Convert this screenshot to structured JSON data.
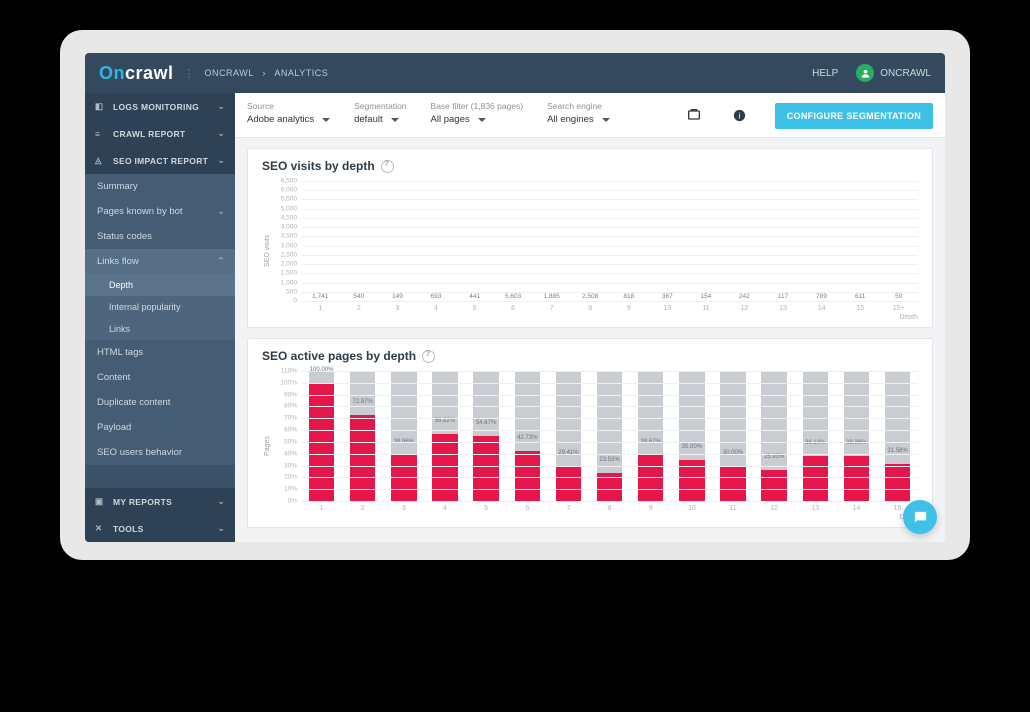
{
  "brand": {
    "on": "On",
    "rest": "crawl"
  },
  "breadcrumb": [
    "ONCRAWL",
    "ANALYTICS"
  ],
  "header": {
    "help": "HELP",
    "user": "ONCRAWL"
  },
  "filters": {
    "source": {
      "label": "Source",
      "value": "Adobe analytics"
    },
    "segmentation": {
      "label": "Segmentation",
      "value": "default"
    },
    "basefilter": {
      "label": "Base filter (1,836 pages)",
      "value": "All pages"
    },
    "engine": {
      "label": "Search engine",
      "value": "All engines"
    },
    "button": "CONFIGURE SEGMENTATION"
  },
  "sidebar": {
    "top": [
      {
        "icon": "◧",
        "label": "LOGS MONITORING"
      },
      {
        "icon": "≡",
        "label": "CRAWL REPORT"
      },
      {
        "icon": "◬",
        "label": "SEO IMPACT REPORT"
      }
    ],
    "subs": [
      {
        "label": "Summary"
      },
      {
        "label": "Pages known by bot",
        "chev": true
      },
      {
        "label": "Status codes"
      },
      {
        "label": "Links flow",
        "open": true,
        "children": [
          {
            "label": "Depth",
            "sel": true
          },
          {
            "label": "Internal popularity"
          },
          {
            "label": "Links"
          }
        ]
      },
      {
        "label": "HTML tags"
      },
      {
        "label": "Content"
      },
      {
        "label": "Duplicate content"
      },
      {
        "label": "Payload"
      },
      {
        "label": "SEO users behavior"
      }
    ],
    "bottom": [
      {
        "icon": "▣",
        "label": "MY REPORTS"
      },
      {
        "icon": "✕",
        "label": "TOOLS"
      }
    ]
  },
  "chart_data": [
    {
      "type": "bar",
      "title": "SEO visits by depth",
      "ylabel": "SEO visits",
      "xlabel": "Depth",
      "ylim": [
        0,
        6500
      ],
      "yticks": [
        0,
        500,
        1000,
        1500,
        2000,
        2500,
        3000,
        3500,
        4000,
        4500,
        5000,
        5500,
        6000,
        6500
      ],
      "categories": [
        "1",
        "2",
        "3",
        "4",
        "5",
        "6",
        "7",
        "8",
        "9",
        "10",
        "11",
        "12",
        "13",
        "14",
        "15"
      ],
      "values": [
        1741,
        540,
        149,
        693,
        441,
        5603,
        1885,
        2508,
        818,
        367,
        154,
        242,
        117,
        789,
        611
      ],
      "extra": {
        "cat": "15+",
        "value_label": "50",
        "value": 50
      }
    },
    {
      "type": "bar",
      "title": "SEO active pages by depth",
      "ylabel": "Pages",
      "xlabel": "Depth",
      "ylim": [
        0,
        110
      ],
      "yticks": [
        0,
        10,
        20,
        30,
        40,
        50,
        60,
        70,
        80,
        90,
        100,
        110
      ],
      "categories": [
        "1",
        "2",
        "3",
        "4",
        "5",
        "6",
        "7",
        "8",
        "9",
        "10",
        "11",
        "12",
        "13",
        "14",
        "15"
      ],
      "values": [
        100.0,
        72.97,
        38.96,
        56.82,
        54.67,
        42.73,
        29.41,
        23.53,
        38.67,
        35.0,
        30.0,
        25.93,
        38.1,
        38.36,
        31.58
      ],
      "value_labels": [
        "100.00%",
        "72.97%",
        "38.96%",
        "56.82%",
        "54.67%",
        "42.73%",
        "29.41%",
        "23.53%",
        "38.67%",
        "35.00%",
        "30.00%",
        "25.93%",
        "38.10%",
        "38.36%",
        "31.58%"
      ]
    }
  ]
}
